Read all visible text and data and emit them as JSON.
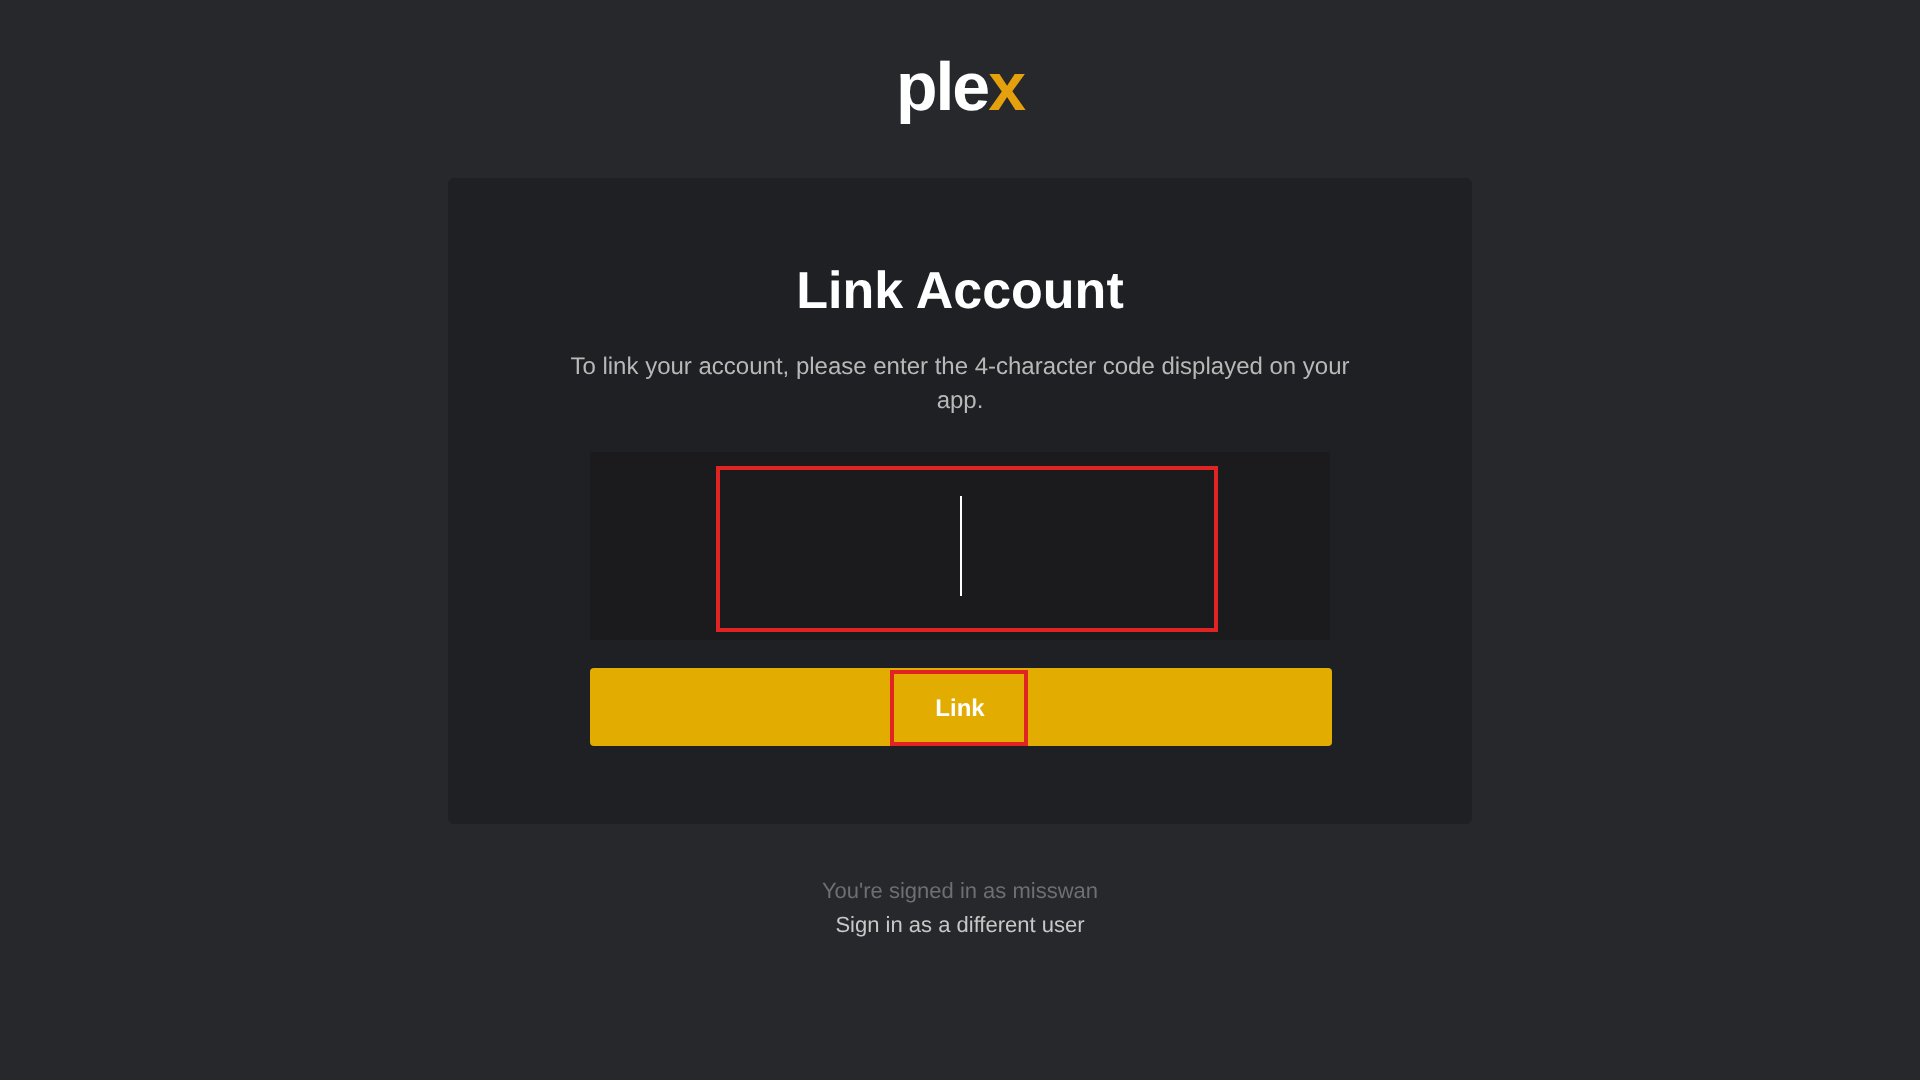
{
  "logo": {
    "main": "ple",
    "accent": "x"
  },
  "card": {
    "title": "Link Account",
    "description": "To link your account, please enter the 4-character code displayed on your app.",
    "code_field": {
      "focused": true,
      "highlighted": true
    },
    "link_button": {
      "label": "Link",
      "highlighted": true
    }
  },
  "footer": {
    "signed_in": "You're signed in as misswan",
    "switch_link": "Sign in as a different user"
  }
}
